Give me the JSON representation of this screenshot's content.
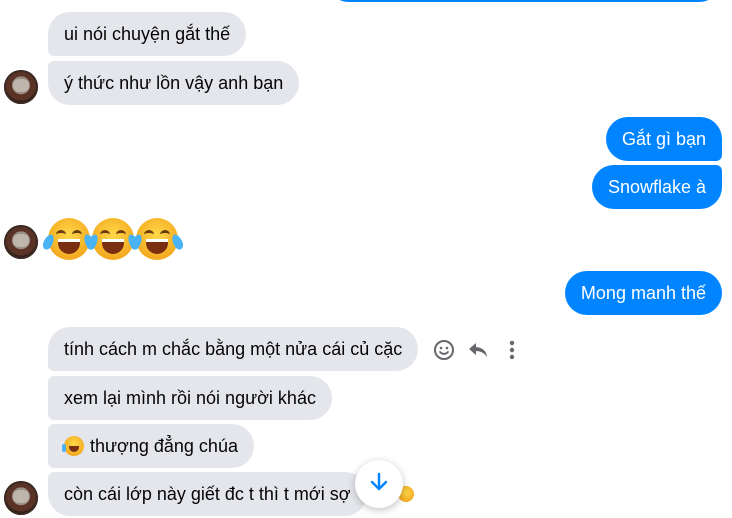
{
  "messages": {
    "m1": "ui nói chuyện gắt thế",
    "m2": "ý thức như lồn vậy anh bạn",
    "m3": "Gắt gì bạn",
    "m4": "Snowflake à",
    "m5_emojis": [
      "face-with-tears-of-joy",
      "face-with-tears-of-joy",
      "face-with-tears-of-joy"
    ],
    "m6": "Mong manh thế",
    "m7": "tính cách m chắc bằng một nửa cái củ cặc",
    "m8": "xem lại mình rồi nói người khác",
    "m9": "thượng đẳng chúa",
    "m10": "còn cái lớp này giết đc t thì t mới sợ"
  },
  "icons": {
    "react": "smiley-icon",
    "reply": "reply-icon",
    "more": "more-vertical-icon",
    "scroll": "arrow-down-icon"
  },
  "colors": {
    "incoming_bubble": "#e4e6eb",
    "outgoing_bubble": "#0084ff",
    "accent": "#0084ff"
  }
}
